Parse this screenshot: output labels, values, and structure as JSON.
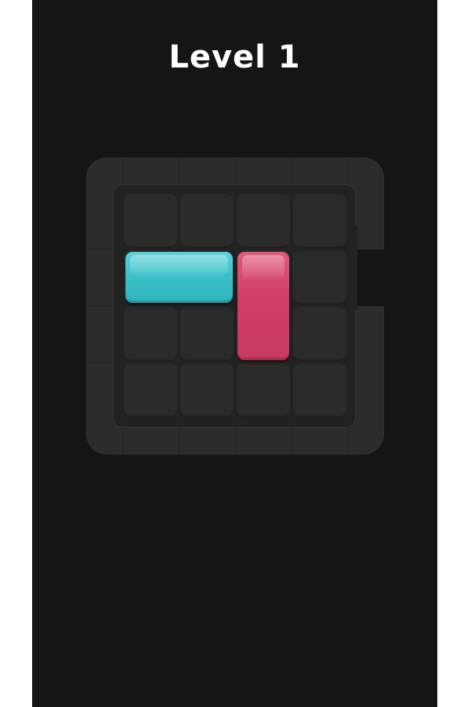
{
  "header": {
    "level_title": "Level 1"
  },
  "board": {
    "rows": 4,
    "cols": 4,
    "exit": {
      "side": "right",
      "row": 2
    },
    "blocks": [
      {
        "id": "cyan",
        "color": "#3cc0c9",
        "orientation": "horizontal",
        "row": 2,
        "col": 1,
        "length": 2
      },
      {
        "id": "pink",
        "color": "#d13f64",
        "orientation": "vertical",
        "row": 2,
        "col": 3,
        "length": 2
      }
    ]
  },
  "colors": {
    "background": "#151515",
    "frame": "#2c2c2c",
    "cell": "#2b2b2b"
  }
}
